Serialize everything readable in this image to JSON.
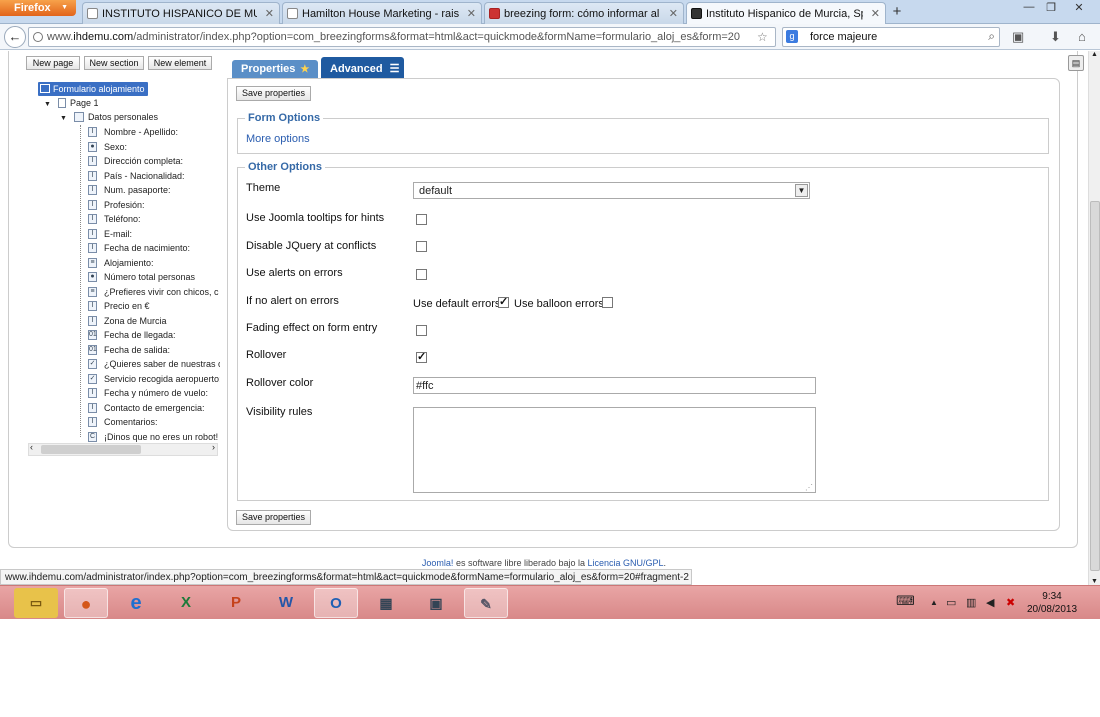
{
  "browser": {
    "menu_label": "Firefox",
    "tabs": [
      {
        "label": "INSTITUTO HISPANICO DE MURCIA"
      },
      {
        "label": "Hamilton House Marketing - raising r..."
      },
      {
        "label": "breezing form: cómo informar al clie..."
      },
      {
        "label": "Instituto Hispanico de Murcia, Spanis..."
      }
    ],
    "url_prefix": "www.",
    "url_domain": "ihdemu.com",
    "url_path": "/administrator/index.php?option=com_breezingforms&format=html&act=quickmode&formName=formulario_aloj_es&form=20",
    "search_engine": "g",
    "search_query": "force majeure",
    "status_url": "www.ihdemu.com/administrator/index.php?option=com_breezingforms&format=html&act=quickmode&formName=formulario_aloj_es&form=20#fragment-2"
  },
  "toolbar": {
    "new_page": "New page",
    "new_section": "New section",
    "new_element": "New element"
  },
  "tree": {
    "root": "Formulario alojamiento",
    "page": "Page 1",
    "section": "Datos personales",
    "items": [
      {
        "label": "Nombre - Apellido:",
        "icon": "text-field-icon",
        "glyph": "I"
      },
      {
        "label": "Sexo:",
        "icon": "radio-icon",
        "glyph": "●"
      },
      {
        "label": "Dirección completa:",
        "icon": "text-field-icon",
        "glyph": "I"
      },
      {
        "label": "País - Nacionalidad:",
        "icon": "text-field-icon",
        "glyph": "I"
      },
      {
        "label": "Num. pasaporte:",
        "icon": "text-field-icon",
        "glyph": "I"
      },
      {
        "label": "Profesión:",
        "icon": "text-field-icon",
        "glyph": "I"
      },
      {
        "label": "Teléfono:",
        "icon": "text-field-icon",
        "glyph": "I"
      },
      {
        "label": "E-mail:",
        "icon": "text-field-icon",
        "glyph": "I"
      },
      {
        "label": "Fecha de nacimiento:",
        "icon": "text-field-icon",
        "glyph": "I"
      },
      {
        "label": "Alojamiento:",
        "icon": "select-list-icon",
        "glyph": "≡"
      },
      {
        "label": "Número total personas",
        "icon": "radio-icon",
        "glyph": "●"
      },
      {
        "label": "¿Prefieres vivir con chicos, c",
        "icon": "select-list-icon",
        "glyph": "≡"
      },
      {
        "label": "Precio en €",
        "icon": "text-field-icon",
        "glyph": "I"
      },
      {
        "label": "Zona de Murcia",
        "icon": "text-field-icon",
        "glyph": "I"
      },
      {
        "label": "Fecha de llegada:",
        "icon": "calendar-icon",
        "glyph": "01"
      },
      {
        "label": "Fecha de salida:",
        "icon": "calendar-icon",
        "glyph": "01"
      },
      {
        "label": "¿Quieres saber de nuestras c",
        "icon": "checkbox-icon",
        "glyph": "✓"
      },
      {
        "label": "Servicio recogida aeropuerto:",
        "icon": "checkbox-icon",
        "glyph": "✓"
      },
      {
        "label": "Fecha y número de vuelo:",
        "icon": "text-field-icon",
        "glyph": "I"
      },
      {
        "label": "Contacto de emergencia:",
        "icon": "text-field-icon",
        "glyph": "I"
      },
      {
        "label": "Comentarios:",
        "icon": "text-field-icon",
        "glyph": "I"
      },
      {
        "label": "¡Dinos que no eres un robot!",
        "icon": "captcha-icon",
        "glyph": "C"
      }
    ]
  },
  "panel": {
    "tab_properties": "Properties",
    "tab_advanced": "Advanced",
    "save_properties": "Save properties",
    "form_options_legend": "Form Options",
    "more_options": "More options",
    "other_options_legend": "Other Options",
    "theme_label": "Theme",
    "theme_value": "default",
    "joomla_tooltips_label": "Use Joomla tooltips for hints",
    "joomla_tooltips_checked": false,
    "disable_jquery_label": "Disable JQuery at conflicts",
    "disable_jquery_checked": false,
    "use_alerts_label": "Use alerts on errors",
    "use_alerts_checked": false,
    "no_alert_label": "If no alert on errors",
    "use_default_errors_label": "Use default errors",
    "use_default_errors_checked": true,
    "use_balloon_errors_label": "Use balloon errors",
    "use_balloon_errors_checked": false,
    "fading_label": "Fading effect on form entry",
    "fading_checked": false,
    "rollover_label": "Rollover",
    "rollover_checked": true,
    "rollover_color_label": "Rollover color",
    "rollover_color_value": "#ffc",
    "visibility_rules_label": "Visibility rules",
    "visibility_rules_value": ""
  },
  "footer": {
    "joomla": "Joomla!",
    "text": " es software libre liberado bajo la ",
    "license": "Licencia GNU/GPL",
    "end": "."
  },
  "taskbar": {
    "time": "9:34",
    "date": "20/08/2013"
  },
  "colors": {
    "accent_blue": "#3569a7",
    "properties_tab": "#5b8fc7",
    "advanced_tab": "#1f5aa0",
    "taskbar": "#d88888",
    "firefox_button": "#e2641b"
  }
}
